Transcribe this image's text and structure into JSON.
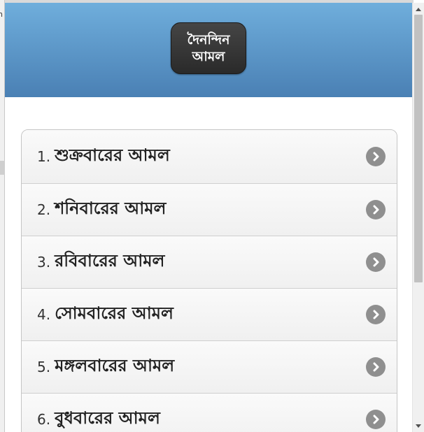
{
  "header": {
    "title_line1": "দৈনন্দিন",
    "title_line2": "আমল"
  },
  "edge_glyph": "n",
  "list": {
    "items": [
      {
        "number": "1.",
        "label": "শুক্রবারের আমল"
      },
      {
        "number": "2.",
        "label": "শনিবারের আমল"
      },
      {
        "number": "3.",
        "label": "রবিবারের আমল"
      },
      {
        "number": "4.",
        "label": "সোমবারের আমল"
      },
      {
        "number": "5.",
        "label": "মঙ্গলবারের আমল"
      },
      {
        "number": "6.",
        "label": "বুধবারের আমল"
      }
    ]
  },
  "icons": {
    "item_arrow": "chevron-right-icon",
    "scroll_up": "scroll-up-arrow-icon",
    "scroll_down": "scroll-down-arrow-icon"
  },
  "colors": {
    "header_top": "#6faedc",
    "header_bottom": "#4a80b4",
    "title_button": "#333333",
    "chevron_circle": "#8f8f8f"
  }
}
